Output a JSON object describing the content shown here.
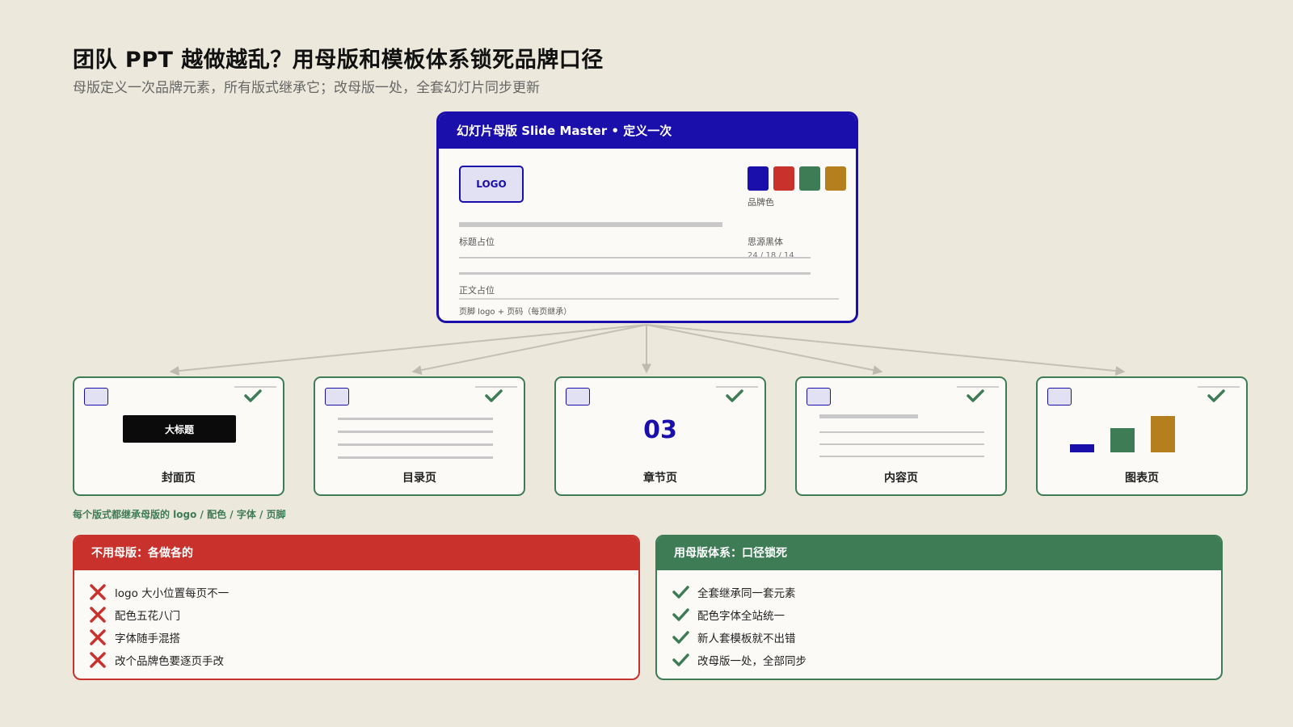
{
  "header": {
    "title": "团队 PPT 越做越乱？用母版和模板体系锁死品牌口径",
    "subtitle": "母版定义一次品牌元素，所有版式继承它；改母版一处，全套幻灯片同步更新"
  },
  "master": {
    "heading": "幻灯片母版 Slide Master  •  定义一次",
    "logo_text": "LOGO",
    "brand_colors_label": "品牌色",
    "brand_colors": [
      "#1A0FAA",
      "#C9322C",
      "#3E7C56",
      "#B57F1D"
    ],
    "title_placeholder": "标题占位",
    "font_name": "思源黑体",
    "font_sizes": "24 / 18 / 14",
    "body_placeholder": "正文占位",
    "footer_placeholder": "页脚 logo + 页码（每页继承）"
  },
  "layouts": [
    {
      "name": "封面页",
      "cover_title": "大标题"
    },
    {
      "name": "目录页"
    },
    {
      "name": "章节页",
      "section_number": "03"
    },
    {
      "name": "内容页"
    },
    {
      "name": "图表页"
    }
  ],
  "inherit_note": "每个版式都继承母版的 logo / 配色 / 字体 / 页脚",
  "comparison": {
    "bad": {
      "heading": "不用母版：各做各的",
      "items": [
        "logo 大小位置每页不一",
        "配色五花八门",
        "字体随手混搭",
        "改个品牌色要逐页手改"
      ]
    },
    "good": {
      "heading": "用母版体系：口径锁死",
      "items": [
        "全套继承同一套元素",
        "配色字体全站统一",
        "新人套模板就不出错",
        "改母版一处，全部同步"
      ]
    }
  },
  "colors": {
    "brand_blue": "#1A0FAA",
    "alert_red": "#C9322C",
    "ok_green": "#3E7C56",
    "gold": "#B57F1D",
    "background": "#ECE8DC"
  }
}
